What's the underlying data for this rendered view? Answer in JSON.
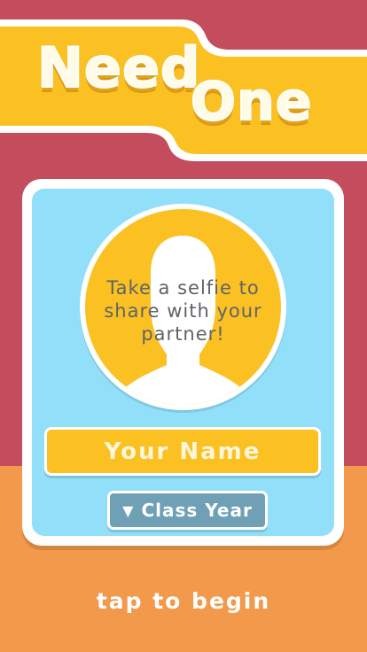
{
  "logo": {
    "word1": "Need",
    "word2": "One"
  },
  "profile": {
    "selfie_prompt": "Take a selfie to share with your partner!",
    "name_placeholder": "Your Name",
    "class_year_label": "Class Year",
    "class_year_icon": "triangle-down-icon"
  },
  "footer": {
    "tap_to_begin": "tap to begin"
  },
  "colors": {
    "background_top": "#c34d5c",
    "background_bottom": "#f2994b",
    "banner_yellow": "#fbc123",
    "card_blue": "#91dff8",
    "select_blue": "#6fa0b5"
  }
}
